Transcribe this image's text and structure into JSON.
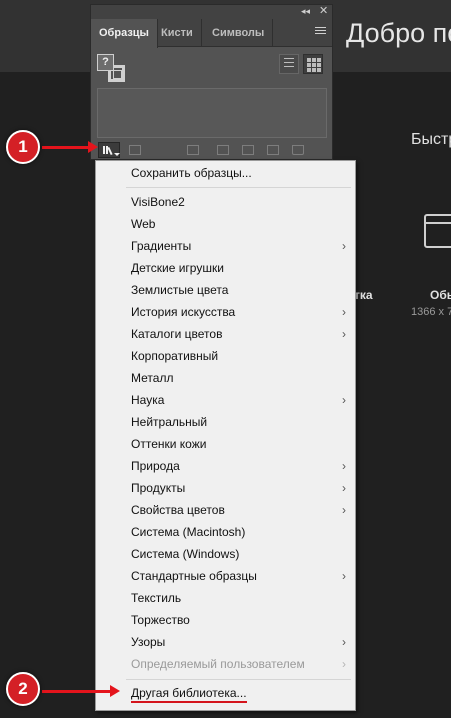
{
  "workspace": {
    "welcome_title": "Добро по",
    "quick_start": "Быстр",
    "preset_left": "тка",
    "preset_right": "Обы",
    "preset_size": "1366 x 7"
  },
  "panel": {
    "tabs": [
      "Образцы",
      "Кисти",
      "Символы"
    ],
    "fill_label": "?"
  },
  "menu": {
    "save": "Сохранить образцы...",
    "items": [
      {
        "label": "VisiBone2",
        "submenu": false,
        "disabled": false
      },
      {
        "label": "Web",
        "submenu": false,
        "disabled": false
      },
      {
        "label": "Градиенты",
        "submenu": true,
        "disabled": false
      },
      {
        "label": "Детские игрушки",
        "submenu": false,
        "disabled": false
      },
      {
        "label": "Землистые цвета",
        "submenu": false,
        "disabled": false
      },
      {
        "label": "История искусства",
        "submenu": true,
        "disabled": false
      },
      {
        "label": "Каталоги цветов",
        "submenu": true,
        "disabled": false
      },
      {
        "label": "Корпоративный",
        "submenu": false,
        "disabled": false
      },
      {
        "label": "Металл",
        "submenu": false,
        "disabled": false
      },
      {
        "label": "Наука",
        "submenu": true,
        "disabled": false
      },
      {
        "label": "Нейтральный",
        "submenu": false,
        "disabled": false
      },
      {
        "label": "Оттенки кожи",
        "submenu": false,
        "disabled": false
      },
      {
        "label": "Природа",
        "submenu": true,
        "disabled": false
      },
      {
        "label": "Продукты",
        "submenu": true,
        "disabled": false
      },
      {
        "label": "Свойства цветов",
        "submenu": true,
        "disabled": false
      },
      {
        "label": "Система (Macintosh)",
        "submenu": false,
        "disabled": false
      },
      {
        "label": "Система (Windows)",
        "submenu": false,
        "disabled": false
      },
      {
        "label": "Стандартные образцы",
        "submenu": true,
        "disabled": false
      },
      {
        "label": "Текстиль",
        "submenu": false,
        "disabled": false
      },
      {
        "label": "Торжество",
        "submenu": false,
        "disabled": false
      },
      {
        "label": "Узоры",
        "submenu": true,
        "disabled": false
      },
      {
        "label": "Определяемый пользователем",
        "submenu": true,
        "disabled": true
      }
    ],
    "other_library": "Другая библиотека..."
  },
  "annotations": {
    "step1": "1",
    "step2": "2",
    "accent_color": "#d42026"
  }
}
